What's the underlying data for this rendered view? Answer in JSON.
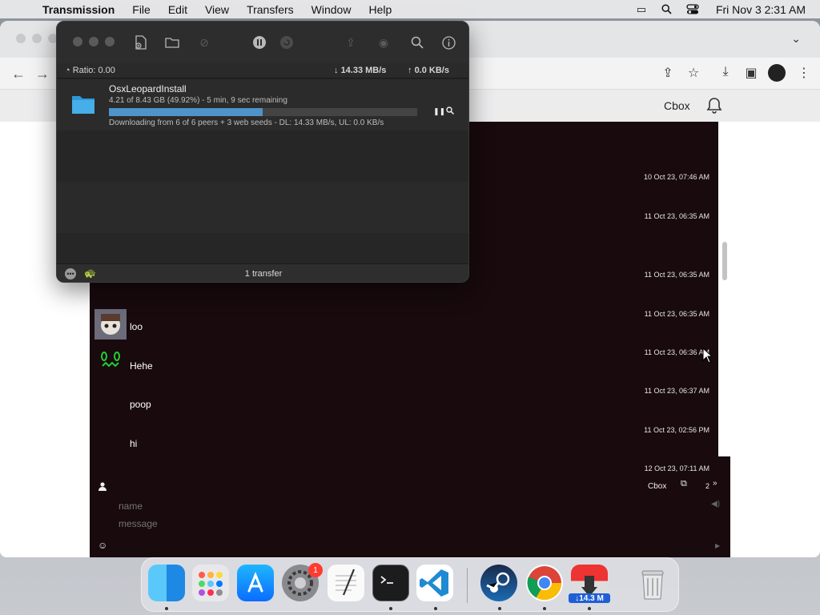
{
  "menubar": {
    "app": "Transmission",
    "items": [
      "File",
      "Edit",
      "View",
      "Transfers",
      "Window",
      "Help"
    ],
    "clock": "Fri Nov 3  2:31 AM"
  },
  "browser": {
    "app_label": "Cbox"
  },
  "chat": {
    "timestamps": [
      "10 Oct 23, 07:46 AM",
      "11 Oct 23, 06:35 AM",
      "11 Oct 23, 06:35 AM",
      "11 Oct 23, 06:35 AM",
      "11 Oct 23, 06:36 AM",
      "11 Oct 23, 06:37 AM",
      "11 Oct 23, 02:56 PM",
      "12 Oct 23, 07:11 AM"
    ],
    "messages": [
      {
        "text": "loo"
      },
      {
        "text": "Hehe"
      },
      {
        "text": "poop"
      },
      {
        "text": "hi"
      }
    ],
    "compose": {
      "label": "Cbox",
      "count": "2",
      "name_placeholder": "name",
      "message_placeholder": "message"
    }
  },
  "transmission": {
    "ratio": "Ratio: 0.00",
    "download_rate": "14.33 MB/s",
    "upload_rate": "0.0 KB/s",
    "torrent": {
      "name": "OsxLeopardInstall",
      "progress_text": "4.21 of 8.43 GB (49.92%) - 5 min, 9 sec remaining",
      "progress_percent": 49.92,
      "status": "Downloading from 6 of 6 peers + 3 web seeds - DL: 14.33 MB/s, UL: 0.0 KB/s"
    },
    "footer_count": "1 transfer"
  },
  "dock": {
    "settings_badge": "1",
    "transmission_label": "14.3 M",
    "icons": [
      "finder-icon",
      "launchpad-icon",
      "app-store-icon",
      "system-settings-icon",
      "textedit-icon",
      "terminal-icon",
      "vscode-icon",
      "steam-icon",
      "chrome-icon",
      "transmission-icon",
      "trash-icon"
    ]
  },
  "colors": {
    "progress": "#4f93c9",
    "chat_bg": "#180a0d",
    "username": "#2a2ad8"
  }
}
